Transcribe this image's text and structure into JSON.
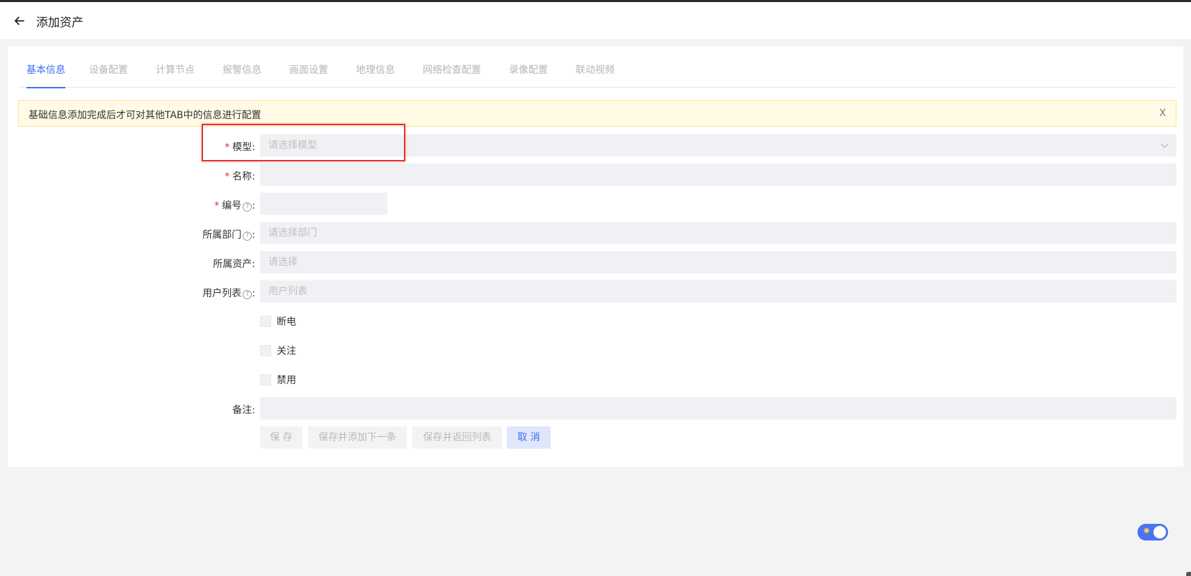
{
  "header": {
    "title": "添加资产",
    "back_icon": "arrow-left-icon"
  },
  "tabs": [
    {
      "label": "基本信息",
      "active": true
    },
    {
      "label": "设备配置",
      "active": false
    },
    {
      "label": "计算节点",
      "active": false
    },
    {
      "label": "报警信息",
      "active": false
    },
    {
      "label": "画面设置",
      "active": false
    },
    {
      "label": "地理信息",
      "active": false
    },
    {
      "label": "网络检查配置",
      "active": false
    },
    {
      "label": "录像配置",
      "active": false
    },
    {
      "label": "联动视频",
      "active": false
    }
  ],
  "alert": {
    "text": "基础信息添加完成后才可对其他TAB中的信息进行配置",
    "close": "X"
  },
  "form": {
    "model": {
      "label": "模型",
      "colon": ":",
      "required": true,
      "placeholder": "请选择模型"
    },
    "name": {
      "label": "名称",
      "colon": ":",
      "required": true,
      "value": ""
    },
    "code": {
      "label": "编号",
      "colon": ":",
      "required": true,
      "help": "?",
      "value": ""
    },
    "department": {
      "label": "所属部门",
      "colon": ":",
      "help": "?",
      "placeholder": "请选择部门"
    },
    "asset": {
      "label": "所属资产",
      "colon": ":",
      "placeholder": "请选择"
    },
    "users": {
      "label": "用户列表",
      "colon": ":",
      "help": "?",
      "placeholder": "用户列表"
    },
    "checkboxes": [
      "断电",
      "关注",
      "禁用"
    ],
    "remark": {
      "label": "备注",
      "colon": ":",
      "value": ""
    }
  },
  "buttons": {
    "save": "保 存",
    "save_add_next": "保存并添加下一条",
    "save_return": "保存并返回列表",
    "cancel": "取 消"
  },
  "colors": {
    "accent": "#3d6df2",
    "required": "#f5222d",
    "highlight": "#e03030"
  }
}
